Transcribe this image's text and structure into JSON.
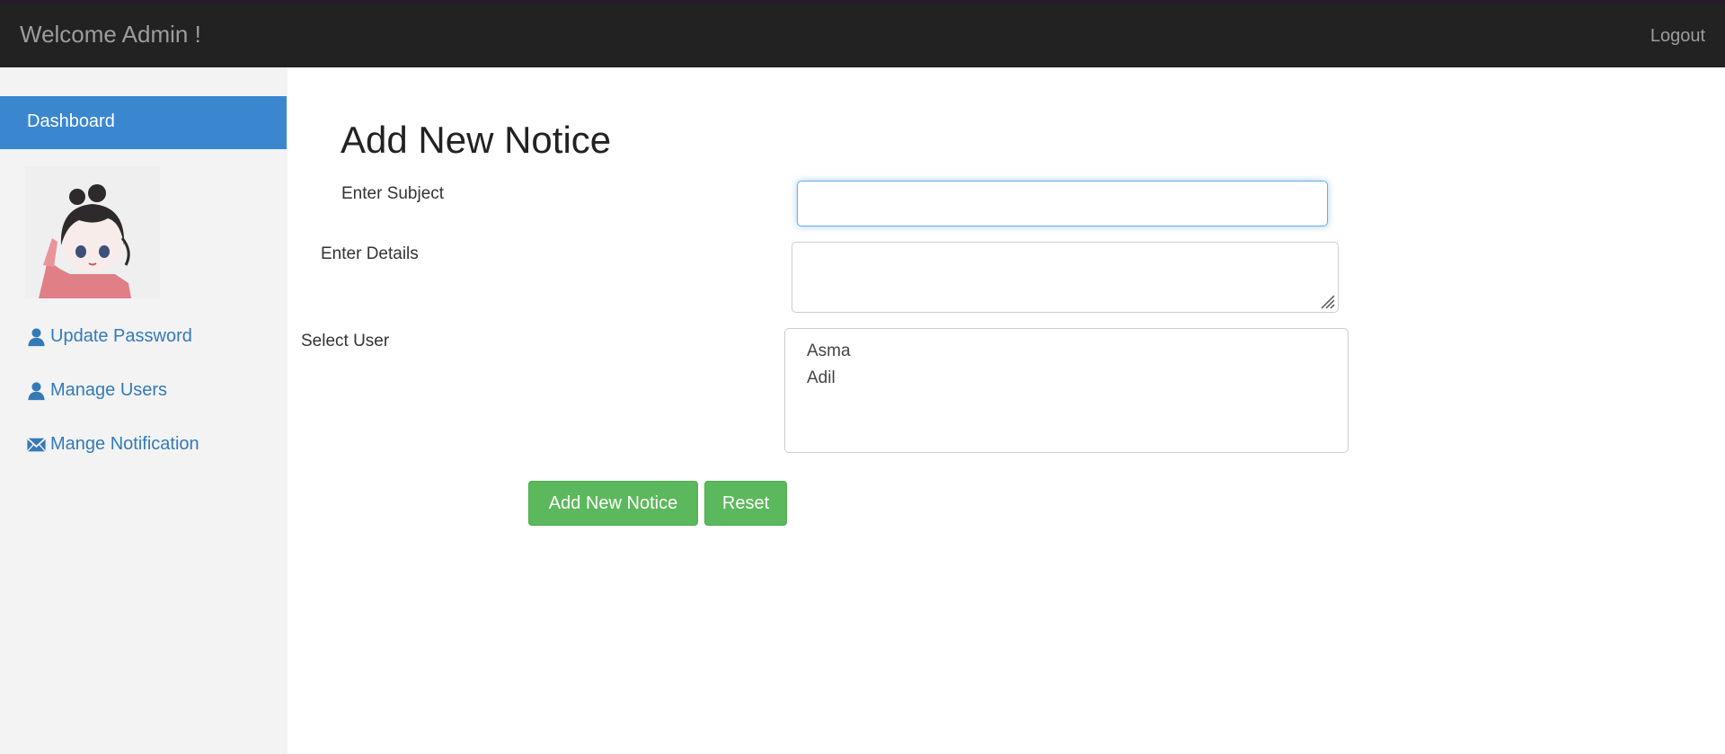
{
  "header": {
    "brand": "Welcome Admin !",
    "logout_label": "Logout"
  },
  "sidebar": {
    "dashboard_label": "Dashboard",
    "items": [
      {
        "label": "Update Password",
        "icon": "user-icon"
      },
      {
        "label": "Manage Users",
        "icon": "user-icon"
      },
      {
        "label": "Mange Notification",
        "icon": "envelope-icon"
      }
    ]
  },
  "form": {
    "title": "Add New Notice",
    "subject_label": "Enter Subject",
    "subject_value": "",
    "details_label": "Enter Details",
    "details_value": "",
    "user_label": "Select User",
    "user_options": [
      "Asma",
      "Adil"
    ],
    "submit_label": "Add New Notice",
    "reset_label": "Reset"
  },
  "colors": {
    "topbar": "#222222",
    "accent": "#3a87cf",
    "link": "#337ab7",
    "success": "#5cb85c"
  }
}
